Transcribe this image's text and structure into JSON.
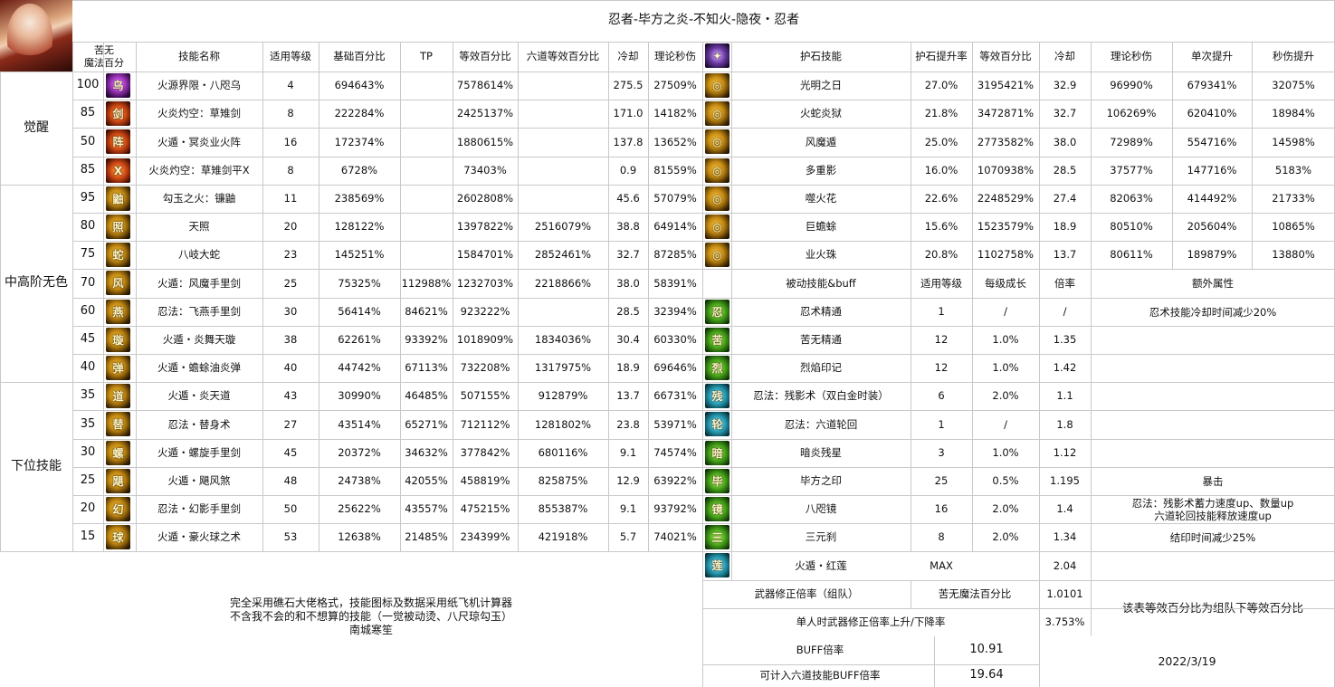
{
  "title": "忍者-毕方之炎-不知火-隐夜・忍者",
  "left_headers": {
    "kunai": "苦无\n魔法百分",
    "name": "技能名称",
    "level": "适用等级",
    "base": "基础百分比",
    "tp": "TP",
    "equiv": "等效百分比",
    "six": "六道等效百分比",
    "cd": "冷却",
    "dps": "理论秒伤"
  },
  "groups": [
    "觉醒",
    "中高阶无色",
    "下位技能"
  ],
  "skills": [
    {
      "k": "100",
      "name": "火源界限・八咫乌",
      "level": "4",
      "base": "694643%",
      "tp": "",
      "equiv": "7578614%",
      "six": "",
      "cd": "275.5",
      "dps": "27509%",
      "icon": "purple-crow-icon"
    },
    {
      "k": "85",
      "name": "火炎灼空：草雉剑",
      "level": "8",
      "base": "222284%",
      "tp": "",
      "equiv": "2425137%",
      "six": "",
      "cd": "171.0",
      "dps": "14182%",
      "icon": "flame-sword-icon"
    },
    {
      "k": "50",
      "name": "火遁・冥炎业火阵",
      "level": "16",
      "base": "172374%",
      "tp": "",
      "equiv": "1880615%",
      "six": "",
      "cd": "137.8",
      "dps": "13652%",
      "icon": "fire-array-icon"
    },
    {
      "k": "85",
      "name": "火炎灼空：草雉剑平X",
      "level": "8",
      "base": "6728%",
      "tp": "",
      "equiv": "73403%",
      "six": "",
      "cd": "0.9",
      "dps": "81559%",
      "icon": "flame-sword-x-icon"
    },
    {
      "k": "95",
      "name": "勾玉之火：镰鼬",
      "level": "11",
      "base": "238569%",
      "tp": "",
      "equiv": "2602808%",
      "six": "",
      "cd": "45.6",
      "dps": "57079%",
      "icon": "magatama-fire-icon"
    },
    {
      "k": "80",
      "name": "天照",
      "level": "20",
      "base": "128122%",
      "tp": "",
      "equiv": "1397822%",
      "six": "2516079%",
      "cd": "38.8",
      "dps": "64914%",
      "icon": "amaterasu-icon"
    },
    {
      "k": "75",
      "name": "八岐大蛇",
      "level": "23",
      "base": "145251%",
      "tp": "",
      "equiv": "1584701%",
      "six": "2852461%",
      "cd": "32.7",
      "dps": "87285%",
      "icon": "orochi-icon"
    },
    {
      "k": "70",
      "name": "火遁：风魔手里剑",
      "level": "25",
      "base": "75325%",
      "tp": "112988%",
      "equiv": "1232703%",
      "six": "2218866%",
      "cd": "38.0",
      "dps": "58391%",
      "icon": "fuma-shuriken-icon"
    },
    {
      "k": "60",
      "name": "忍法：飞燕手里剑",
      "level": "30",
      "base": "56414%",
      "tp": "84621%",
      "equiv": "923222%",
      "six": "",
      "cd": "28.5",
      "dps": "32394%",
      "icon": "swallow-shuriken-icon"
    },
    {
      "k": "45",
      "name": "火遁・炎舞天璇",
      "level": "38",
      "base": "62261%",
      "tp": "93392%",
      "equiv": "1018909%",
      "six": "1834036%",
      "cd": "30.4",
      "dps": "60330%",
      "icon": "flame-dance-icon"
    },
    {
      "k": "40",
      "name": "火遁・蟾蜍油炎弹",
      "level": "40",
      "base": "44742%",
      "tp": "67113%",
      "equiv": "732208%",
      "six": "1317975%",
      "cd": "18.9",
      "dps": "69646%",
      "icon": "toad-oil-icon"
    },
    {
      "k": "35",
      "name": "火遁・炎天道",
      "level": "43",
      "base": "30990%",
      "tp": "46485%",
      "equiv": "507155%",
      "six": "912879%",
      "cd": "13.7",
      "dps": "66731%",
      "icon": "flame-path-icon"
    },
    {
      "k": "35",
      "name": "忍法・替身术",
      "level": "27",
      "base": "43514%",
      "tp": "65271%",
      "equiv": "712112%",
      "six": "1281802%",
      "cd": "23.8",
      "dps": "53971%",
      "icon": "substitution-icon"
    },
    {
      "k": "30",
      "name": "火遁・螺旋手里剑",
      "level": "45",
      "base": "20372%",
      "tp": "34632%",
      "equiv": "377842%",
      "six": "680116%",
      "cd": "9.1",
      "dps": "74574%",
      "icon": "spiral-shuriken-icon"
    },
    {
      "k": "25",
      "name": "火遁・飓风煞",
      "level": "48",
      "base": "24738%",
      "tp": "42055%",
      "equiv": "458819%",
      "six": "825875%",
      "cd": "12.9",
      "dps": "63922%",
      "icon": "hurricane-icon"
    },
    {
      "k": "20",
      "name": "忍法・幻影手里剑",
      "level": "50",
      "base": "25622%",
      "tp": "43557%",
      "equiv": "475215%",
      "six": "855387%",
      "cd": "9.1",
      "dps": "93792%",
      "icon": "phantom-shuriken-icon"
    },
    {
      "k": "15",
      "name": "火遁・豪火球之术",
      "level": "53",
      "base": "12638%",
      "tp": "21485%",
      "equiv": "234399%",
      "six": "421918%",
      "cd": "5.7",
      "dps": "74021%",
      "icon": "fireball-icon"
    }
  ],
  "talisman_headers": {
    "name": "护石技能",
    "rate": "护石提升率",
    "equiv": "等效百分比",
    "cd": "冷却",
    "dps": "理论秒伤",
    "single": "单次提升",
    "gain": "秒伤提升"
  },
  "talismans": [
    {
      "name": "光明之日",
      "rate": "27.0%",
      "equiv": "3195421%",
      "cd": "32.9",
      "dps": "96990%",
      "single": "679341%",
      "gain": "32075%",
      "icon": "bright-sun-icon"
    },
    {
      "name": "火蛇炎狱",
      "rate": "21.8%",
      "equiv": "3472871%",
      "cd": "32.7",
      "dps": "106269%",
      "single": "620410%",
      "gain": "18984%",
      "icon": "fire-snake-icon"
    },
    {
      "name": "风魔遁",
      "rate": "25.0%",
      "equiv": "2773582%",
      "cd": "38.0",
      "dps": "72989%",
      "single": "554716%",
      "gain": "14598%",
      "icon": "fuma-escape-icon"
    },
    {
      "name": "多重影",
      "rate": "16.0%",
      "equiv": "1070938%",
      "cd": "28.5",
      "dps": "37577%",
      "single": "147716%",
      "gain": "5183%",
      "icon": "multi-shadow-icon"
    },
    {
      "name": "噬火花",
      "rate": "22.6%",
      "equiv": "2248529%",
      "cd": "27.4",
      "dps": "82063%",
      "single": "414492%",
      "gain": "21733%",
      "icon": "devour-spark-icon"
    },
    {
      "name": "巨蟾蜍",
      "rate": "15.6%",
      "equiv": "1523579%",
      "cd": "18.9",
      "dps": "80510%",
      "single": "205604%",
      "gain": "10865%",
      "icon": "giant-toad-icon"
    },
    {
      "name": "业火珠",
      "rate": "20.8%",
      "equiv": "1102758%",
      "cd": "13.7",
      "dps": "80611%",
      "single": "189879%",
      "gain": "13880%",
      "icon": "karma-orb-icon"
    }
  ],
  "passive_headers": {
    "name": "被动技能&buff",
    "level": "适用等级",
    "growth": "每级成长",
    "mult": "倍率",
    "extra": "额外属性"
  },
  "passives": [
    {
      "name": "忍术精通",
      "level": "1",
      "growth": "/",
      "mult": "/",
      "extra": "忍术技能冷却时间减少20%",
      "icon": "ninjutsu-mastery-icon"
    },
    {
      "name": "苦无精通",
      "level": "12",
      "growth": "1.0%",
      "mult": "1.35",
      "extra": "",
      "icon": "kunai-mastery-icon"
    },
    {
      "name": "烈焰印记",
      "level": "12",
      "growth": "1.0%",
      "mult": "1.42",
      "extra": "",
      "icon": "flame-mark-icon"
    },
    {
      "name": "忍法：残影术（双白金时装）",
      "level": "6",
      "growth": "2.0%",
      "mult": "1.1",
      "extra": "",
      "icon": "afterimage-icon"
    },
    {
      "name": "忍法：六道轮回",
      "level": "1",
      "growth": "/",
      "mult": "1.8",
      "extra": "",
      "icon": "six-paths-icon"
    },
    {
      "name": "暗炎残星",
      "level": "3",
      "growth": "1.0%",
      "mult": "1.12",
      "extra": "",
      "icon": "dark-flame-star-icon"
    },
    {
      "name": "毕方之印",
      "level": "25",
      "growth": "0.5%",
      "mult": "1.195",
      "extra": "暴击",
      "icon": "bifang-seal-icon"
    },
    {
      "name": "八咫镜",
      "level": "16",
      "growth": "2.0%",
      "mult": "1.4",
      "extra": "忍法：残影术蓄力速度up、数量up\n六道轮回技能释放速度up",
      "icon": "yata-mirror-icon"
    },
    {
      "name": "三元刹",
      "level": "8",
      "growth": "2.0%",
      "mult": "1.34",
      "extra": "结印时间减少25%",
      "icon": "triple-element-icon"
    },
    {
      "name": "火遁・红莲",
      "level": "MAX",
      "growth": "",
      "mult": "2.04",
      "extra": "",
      "icon": "crimson-lotus-icon"
    }
  ],
  "weapon": {
    "label": "武器修正倍率（组队）",
    "kunai_label": "苦无魔法百分比",
    "value": "1.0101",
    "note": "该表等效百分比为组队下等效百分比",
    "solo_label": "单人时武器修正倍率上升/下降率",
    "solo_value": "3.753%"
  },
  "buff": {
    "label": "BUFF倍率",
    "value": "10.91",
    "six_label": "可计入六道技能BUFF倍率",
    "six_value": "19.64"
  },
  "date": "2022/3/19",
  "notes": [
    "完全采用礁石大佬格式，技能图标及数据采用纸飞机计算器",
    "不含我不会的和不想算的技能（一觉被动烫、八尺琼勾玉）",
    "南城寒笙"
  ]
}
